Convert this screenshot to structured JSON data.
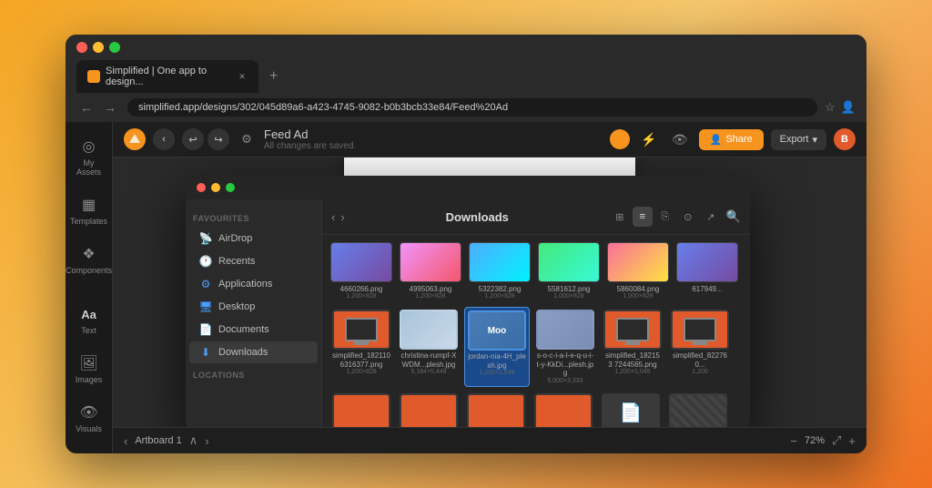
{
  "browser": {
    "tab_label": "Simplified | One app to design...",
    "new_tab": "+",
    "address": "simplified.app/designs/302/045d89a6-a423-4745-9082-b0b3bcb33e84/Feed%20Ad",
    "back_btn": "←",
    "forward_btn": "→",
    "reload_btn": "↻"
  },
  "toolbar": {
    "logo": "S",
    "back_btn": "‹",
    "undo_btn": "↩",
    "redo_btn": "↪",
    "settings_btn": "⚙",
    "title": "Feed Ad",
    "subtitle": "All changes are saved.",
    "share_label": "Share",
    "export_label": "Export",
    "export_arrow": "▾",
    "user_initial": "B"
  },
  "sidebar": {
    "items": [
      {
        "label": "My Assets",
        "icon": "◎"
      },
      {
        "label": "Templates",
        "icon": "▦"
      },
      {
        "label": "Components",
        "icon": "❖"
      },
      {
        "label": "Text",
        "icon": "Aa"
      },
      {
        "label": "Images",
        "icon": "🖼"
      },
      {
        "label": "Visuals",
        "icon": "👁"
      }
    ],
    "play_icon": "▶"
  },
  "canvas": {
    "artboard_label": "Artboard 1",
    "prev_btn": "‹",
    "next_btn": "›",
    "up_btn": "∧",
    "zoom_out": "−",
    "zoom_level": "72%",
    "zoom_in": "+",
    "fullscreen": "⤢"
  },
  "file_picker": {
    "title": "Downloads",
    "nav_back": "‹",
    "nav_forward": "›",
    "favorites_label": "Favourites",
    "sidebar_items": [
      {
        "label": "AirDrop",
        "icon": "📡",
        "color": "blue"
      },
      {
        "label": "Recents",
        "icon": "🕐",
        "color": "blue"
      },
      {
        "label": "Applications",
        "icon": "⬡",
        "color": "blue"
      },
      {
        "label": "Desktop",
        "icon": "🖥",
        "color": "blue"
      },
      {
        "label": "Documents",
        "icon": "📄",
        "color": "blue"
      },
      {
        "label": "Downloads",
        "icon": "⬇",
        "color": "blue"
      }
    ],
    "locations_label": "Locations",
    "top_files": [
      {
        "name": "4660266.png",
        "size": "1,200×828",
        "color": "gradient1"
      },
      {
        "name": "4995063.png",
        "size": "1,200×828",
        "color": "gradient2"
      },
      {
        "name": "5322382.png",
        "size": "1,200×828",
        "color": "gradient3"
      },
      {
        "name": "5581612.png",
        "size": "1,000×828",
        "color": "gradient4"
      },
      {
        "name": "5860084.png",
        "size": "1,000×828",
        "color": "gradient5"
      },
      {
        "name": "617949...",
        "size": "",
        "color": "gradient1"
      }
    ],
    "grid_files": [
      {
        "name": "simplified_182110 6316377.png",
        "size": "1,200×828",
        "type": "orange",
        "selected": false
      },
      {
        "name": "christina-rumpf-XWDM...plesh.jpg",
        "size": "5,184×5,449",
        "type": "photo",
        "selected": false
      },
      {
        "name": "jordan-nia-4H_plesh.jpg",
        "size": "1,200×1,649",
        "type": "photo",
        "selected": true
      },
      {
        "name": "s-o-c-i-a-l-e-q-u-i-t-y-KkDi...plesh.jpg",
        "size": "5,000×3,333",
        "type": "photo",
        "selected": false
      },
      {
        "name": "simplified_182153 7244565.png",
        "size": "1,200×1,049",
        "type": "orange",
        "selected": false
      },
      {
        "name": "simplified_822760...",
        "size": "1,200",
        "type": "orange",
        "selected": false
      }
    ],
    "bottom_row_files": [
      {
        "type": "orange"
      },
      {
        "type": "orange"
      },
      {
        "type": "orange"
      },
      {
        "type": "orange"
      },
      {
        "type": "doc"
      }
    ],
    "dragging_file": {
      "name": "jordan-nia-4H_plesh.jpg"
    }
  }
}
